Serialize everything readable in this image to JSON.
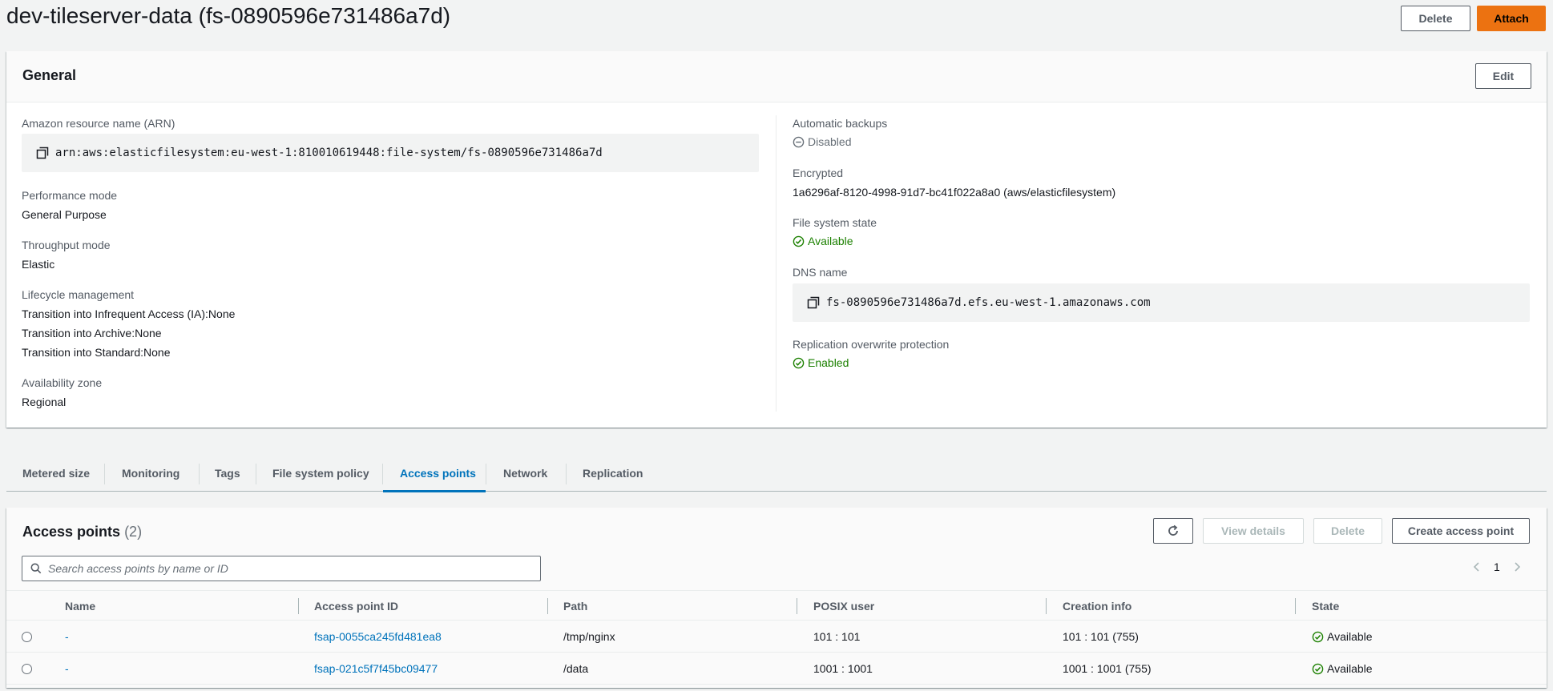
{
  "header": {
    "title": "dev-tileserver-data (fs-0890596e731486a7d)",
    "delete_label": "Delete",
    "attach_label": "Attach"
  },
  "general": {
    "title": "General",
    "edit_label": "Edit",
    "arn_label": "Amazon resource name (ARN)",
    "arn_value": "arn:aws:elasticfilesystem:eu-west-1:810010619448:file-system/fs-0890596e731486a7d",
    "performance_label": "Performance mode",
    "performance_value": "General Purpose",
    "throughput_label": "Throughput mode",
    "throughput_value": "Elastic",
    "lifecycle_label": "Lifecycle management",
    "lifecycle_ia_label": "Transition into Infrequent Access (IA):",
    "lifecycle_ia_value": "None",
    "lifecycle_archive_label": "Transition into Archive:",
    "lifecycle_archive_value": "None",
    "lifecycle_standard_label": "Transition into Standard:",
    "lifecycle_standard_value": "None",
    "az_label": "Availability zone",
    "az_value": "Regional",
    "backups_label": "Automatic backups",
    "backups_value": "Disabled",
    "encrypted_label": "Encrypted",
    "encrypted_value": "1a6296af-8120-4998-91d7-bc41f022a8a0 (aws/elasticfilesystem)",
    "state_label": "File system state",
    "state_value": "Available",
    "dns_label": "DNS name",
    "dns_value": "fs-0890596e731486a7d.efs.eu-west-1.amazonaws.com",
    "replication_label": "Replication overwrite protection",
    "replication_value": "Enabled"
  },
  "tabs": [
    {
      "label": "Metered size"
    },
    {
      "label": "Monitoring"
    },
    {
      "label": "Tags"
    },
    {
      "label": "File system policy"
    },
    {
      "label": "Access points"
    },
    {
      "label": "Network"
    },
    {
      "label": "Replication"
    }
  ],
  "active_tab": "Access points",
  "access_points": {
    "title": "Access points",
    "count": "(2)",
    "view_details_label": "View details",
    "delete_label": "Delete",
    "create_label": "Create access point",
    "search_placeholder": "Search access points by name or ID",
    "page": "1",
    "columns": [
      "Name",
      "Access point ID",
      "Path",
      "POSIX user",
      "Creation info",
      "State"
    ],
    "rows": [
      {
        "name": "-",
        "id": "fsap-0055ca245fd481ea8",
        "path": "/tmp/nginx",
        "posix": "101 : 101",
        "creation": "101 : 101 (755)",
        "state": "Available"
      },
      {
        "name": "-",
        "id": "fsap-021c5f7f45bc09477",
        "path": "/data",
        "posix": "1001 : 1001",
        "creation": "1001 : 1001 (755)",
        "state": "Available"
      }
    ]
  },
  "colors": {
    "accent": "#0073bb",
    "primary_button": "#ec7211",
    "success": "#1d8102"
  }
}
